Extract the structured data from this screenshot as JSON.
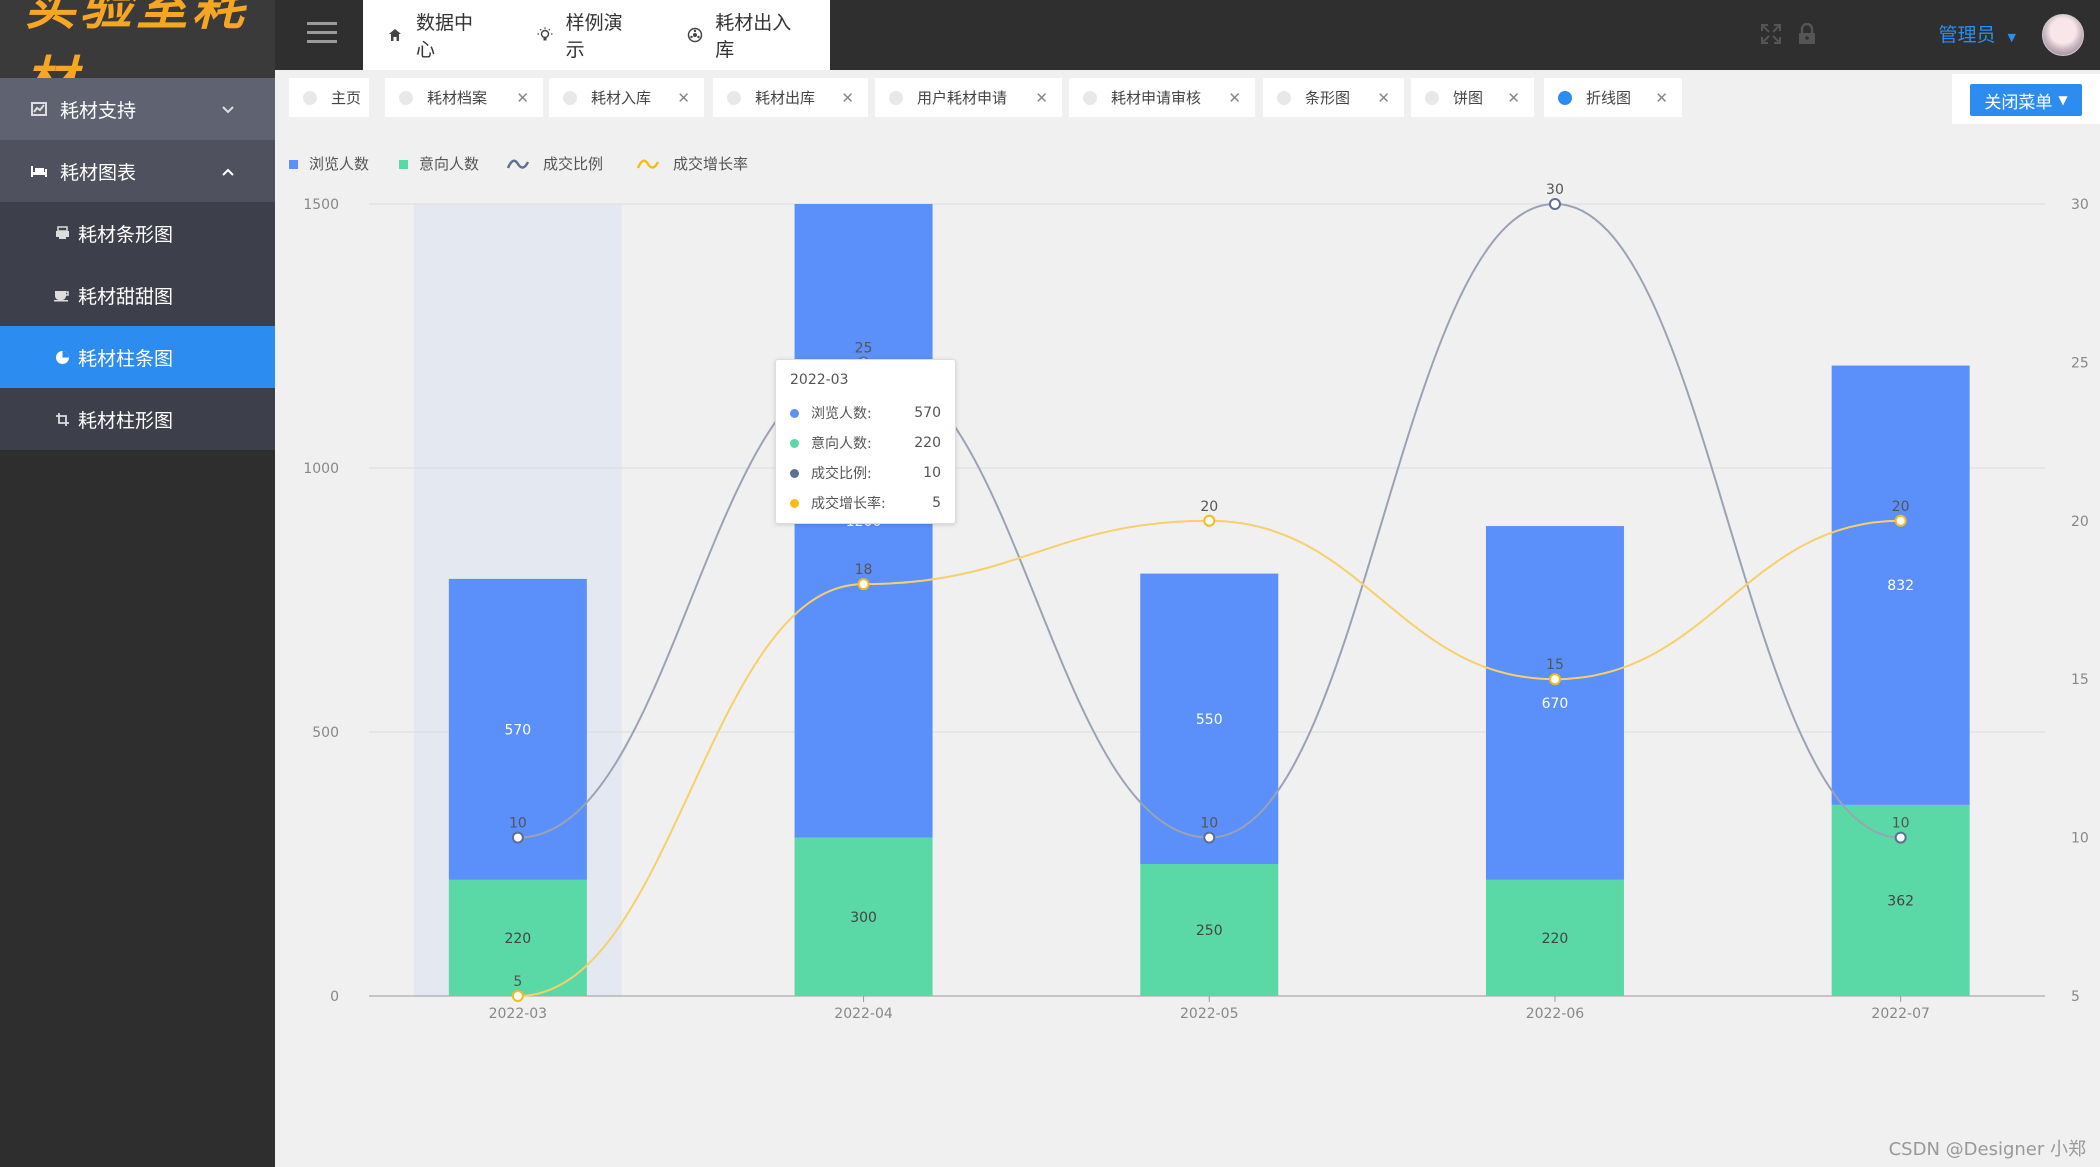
{
  "app": {
    "logo_text": "实验室耗材"
  },
  "sidebar": {
    "groups": [
      {
        "label": "耗材支持",
        "icon": "chart-box-icon",
        "expanded": false
      },
      {
        "label": "耗材图表",
        "icon": "bed-icon",
        "expanded": true
      }
    ],
    "items": [
      {
        "label": "耗材条形图",
        "icon": "printer-icon",
        "active": false
      },
      {
        "label": "耗材甜甜图",
        "icon": "coffee-icon",
        "active": false
      },
      {
        "label": "耗材柱条图",
        "icon": "pie-icon",
        "active": true
      },
      {
        "label": "耗材柱形图",
        "icon": "crop-icon",
        "active": false
      }
    ]
  },
  "topbar": {
    "tabs": [
      {
        "label": "数据中心",
        "icon": "home-icon"
      },
      {
        "label": "样例演示",
        "icon": "bulb-icon"
      },
      {
        "label": "耗材出入库",
        "icon": "settings-icon"
      }
    ],
    "user": "管理员"
  },
  "tagbar": {
    "tags": [
      {
        "label": "主页",
        "closable": false,
        "active": false
      },
      {
        "label": "耗材档案",
        "closable": true,
        "active": false
      },
      {
        "label": "耗材入库",
        "closable": true,
        "active": false
      },
      {
        "label": "耗材出库",
        "closable": true,
        "active": false
      },
      {
        "label": "用户耗材申请",
        "closable": true,
        "active": false
      },
      {
        "label": "耗材申请审核",
        "closable": true,
        "active": false
      },
      {
        "label": "条形图",
        "closable": true,
        "active": false
      },
      {
        "label": "饼图",
        "closable": true,
        "active": false
      },
      {
        "label": "折线图",
        "closable": true,
        "active": true
      }
    ],
    "close_menu_label": "关闭菜单",
    "close_glyph": "✕"
  },
  "chart_data": {
    "type": "bar",
    "stacked": true,
    "categories": [
      "2022-03",
      "2022-04",
      "2022-05",
      "2022-06",
      "2022-07"
    ],
    "series": [
      {
        "name": "浏览人数",
        "type": "bar",
        "axis": "left",
        "color": "#5b8ff9",
        "values": [
          570,
          1200,
          550,
          670,
          832
        ]
      },
      {
        "name": "意向人数",
        "type": "bar",
        "axis": "left",
        "color": "#5ad8a6",
        "values": [
          220,
          300,
          250,
          220,
          362
        ]
      },
      {
        "name": "成交比例",
        "type": "line",
        "axis": "right",
        "color": "#9aa3b5",
        "point_color": "#5d7092",
        "values": [
          10,
          25,
          10,
          30,
          10
        ]
      },
      {
        "name": "成交增长率",
        "type": "line",
        "axis": "right",
        "color": "#f6d06a",
        "point_color": "#f6bd16",
        "values": [
          5,
          18,
          20,
          15,
          20
        ]
      }
    ],
    "y_left": {
      "min": 0,
      "max": 1500,
      "ticks": [
        "0",
        "500",
        "1000",
        "1500"
      ]
    },
    "y_right": {
      "min": 5,
      "max": 30,
      "ticks": [
        "5",
        "10",
        "15",
        "20",
        "25",
        "30"
      ]
    },
    "legend_position": "top-left",
    "grid": true,
    "highlight_category": "2022-03"
  },
  "tooltip": {
    "title": "2022-03",
    "rows": [
      {
        "name": "浏览人数:",
        "value": "570",
        "color": "#5b8ff9"
      },
      {
        "name": "意向人数:",
        "value": "220",
        "color": "#5ad8a6"
      },
      {
        "name": "成交比例:",
        "value": "10",
        "color": "#5d7092"
      },
      {
        "name": "成交增长率:",
        "value": "5",
        "color": "#f6bd16"
      }
    ]
  },
  "watermark": "CSDN @Designer 小郑"
}
